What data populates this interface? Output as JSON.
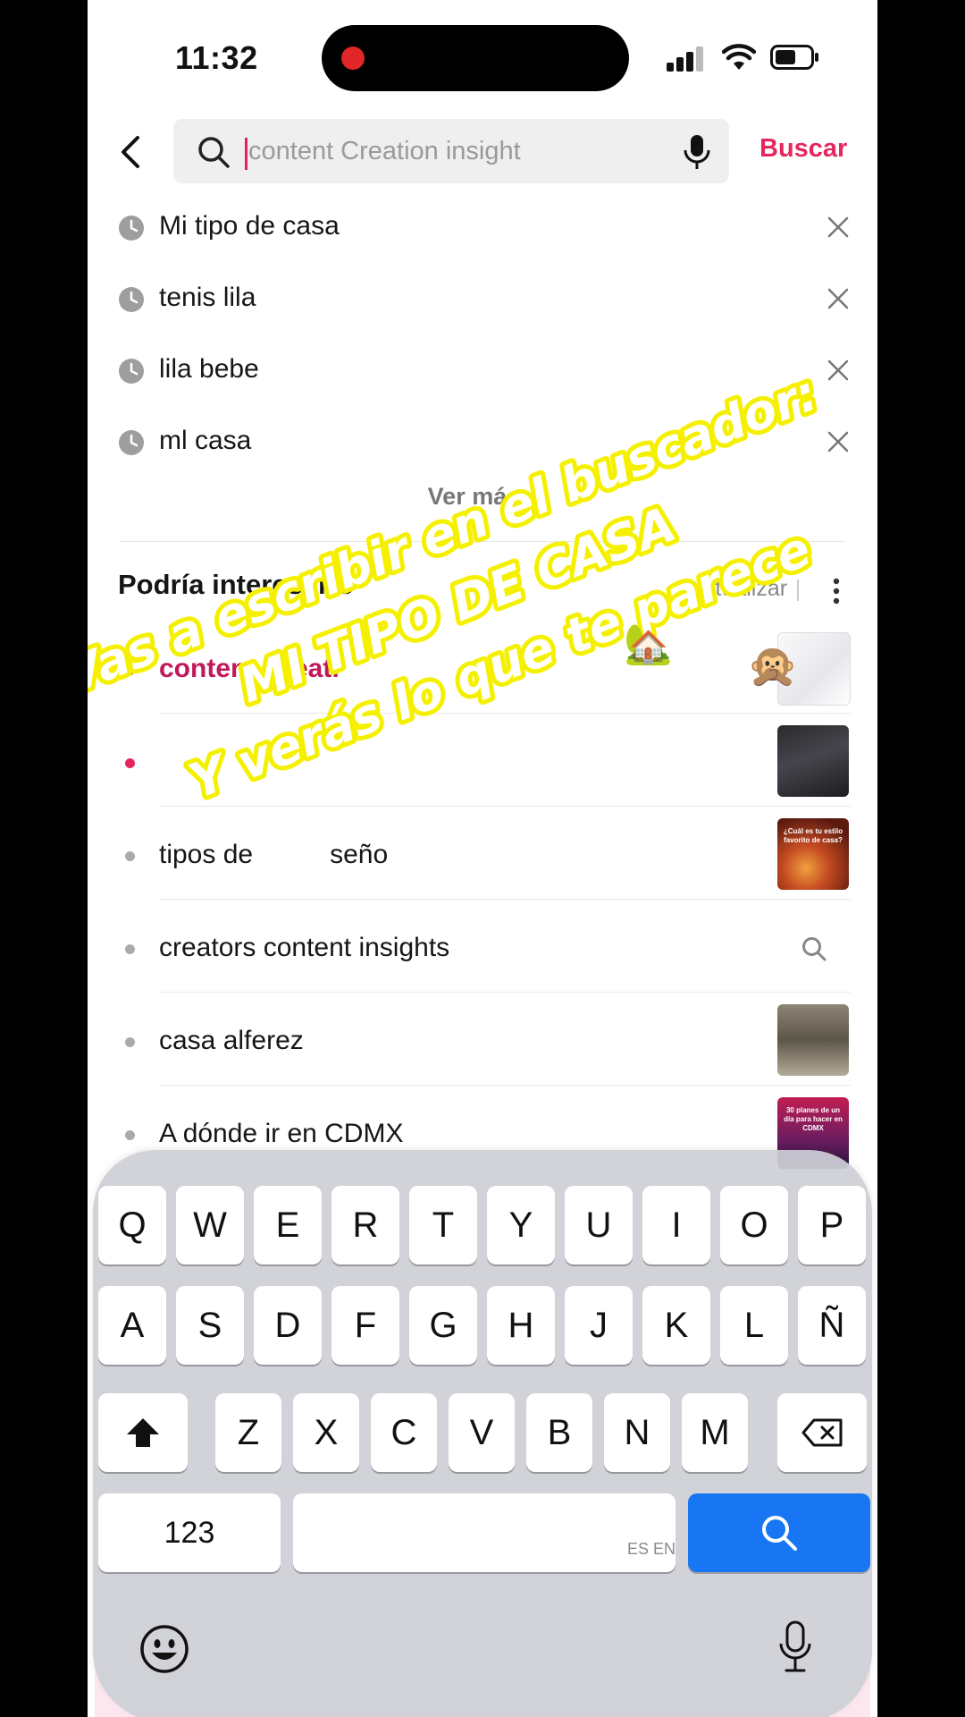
{
  "status_bar": {
    "time": "11:32"
  },
  "search": {
    "placeholder": "content Creation insight",
    "submit_label": "Buscar"
  },
  "recent_searches": [
    {
      "label": "Mi tipo de casa"
    },
    {
      "label": "tenis lila"
    },
    {
      "label": "lila bebe"
    },
    {
      "label": "ml casa"
    }
  ],
  "see_more_label": "Ver más",
  "suggestions_section": {
    "title": "Podría interesarte",
    "refresh_label": "ctualizar"
  },
  "suggestions": [
    {
      "label": "content Creati",
      "highlight": true,
      "thumb": "thumb1"
    },
    {
      "label": "",
      "highlight": true,
      "thumb": "thumb2"
    },
    {
      "label": "tipos de",
      "label_tail": "seño",
      "thumb": "thumb3",
      "thumb_text": "¿Cuál es tu estilo favorito de casa?"
    },
    {
      "label": "creators content insights",
      "thumb": "search-icon"
    },
    {
      "label": "casa alferez",
      "thumb": "thumb4"
    },
    {
      "label": "A dónde ir en CDMX",
      "thumb": "thumb5",
      "thumb_text": "30 planes de un día para hacer en CDMX"
    }
  ],
  "overlay_caption": {
    "line1": "Vas a escribir en el buscador:",
    "line2": "MI TIPO DE CASA",
    "line3": "Y verás lo que te parece",
    "emoji_house": "🏡",
    "emoji_monkey": "🙊"
  },
  "keyboard": {
    "row1": [
      "Q",
      "W",
      "E",
      "R",
      "T",
      "Y",
      "U",
      "I",
      "O",
      "P"
    ],
    "row2": [
      "A",
      "S",
      "D",
      "F",
      "G",
      "H",
      "J",
      "K",
      "L",
      "Ñ"
    ],
    "row3": [
      "Z",
      "X",
      "C",
      "V",
      "B",
      "N",
      "M"
    ],
    "numbers_label": "123",
    "languages_label": "ES EN"
  },
  "colors": {
    "accent": "#e6275f",
    "keyboard_search": "#1976f2",
    "overlay_text_stroke": "#f5f000"
  }
}
